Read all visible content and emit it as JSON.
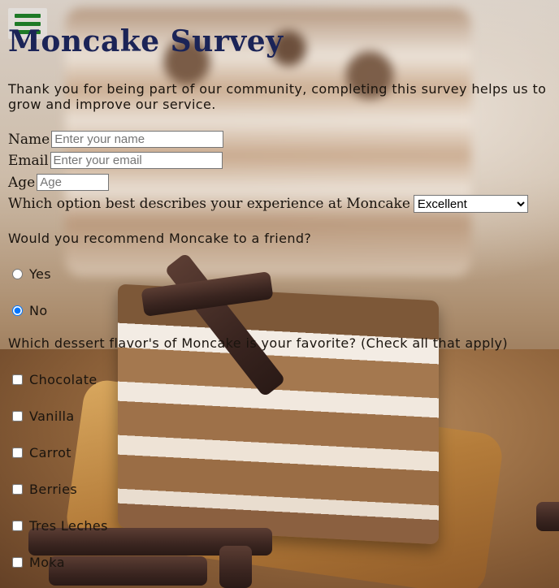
{
  "nav": {
    "menu_icon": "hamburger-menu-icon",
    "accent_color": "#1e7a26"
  },
  "header": {
    "title": "Moncake Survey",
    "intro": "Thank you for being part of our community, completing this survey helps us to grow and improve our service."
  },
  "form": {
    "name": {
      "label": "Name",
      "placeholder": "Enter your name",
      "value": ""
    },
    "email": {
      "label": "Email",
      "placeholder": "Enter your email",
      "value": ""
    },
    "age": {
      "label": "Age",
      "placeholder": "Age",
      "value": ""
    },
    "experience": {
      "label": "Which option best describes your experience at Moncake",
      "selected": "Excellent"
    },
    "recommend": {
      "question": "Would you recommend Moncake to a friend?",
      "options": [
        {
          "label": "Yes",
          "checked": false
        },
        {
          "label": "No",
          "checked": true
        }
      ]
    },
    "flavors": {
      "question": "Which dessert flavor's of Moncake is your favorite? (Check all that apply)",
      "options": [
        {
          "label": "Chocolate",
          "checked": false
        },
        {
          "label": "Vanilla",
          "checked": false
        },
        {
          "label": "Carrot",
          "checked": false
        },
        {
          "label": "Berries",
          "checked": false
        },
        {
          "label": "Tres Leches",
          "checked": false
        },
        {
          "label": "Moka",
          "checked": false
        }
      ]
    }
  },
  "colors": {
    "title": "#1b2457",
    "text": "#1a140e"
  }
}
